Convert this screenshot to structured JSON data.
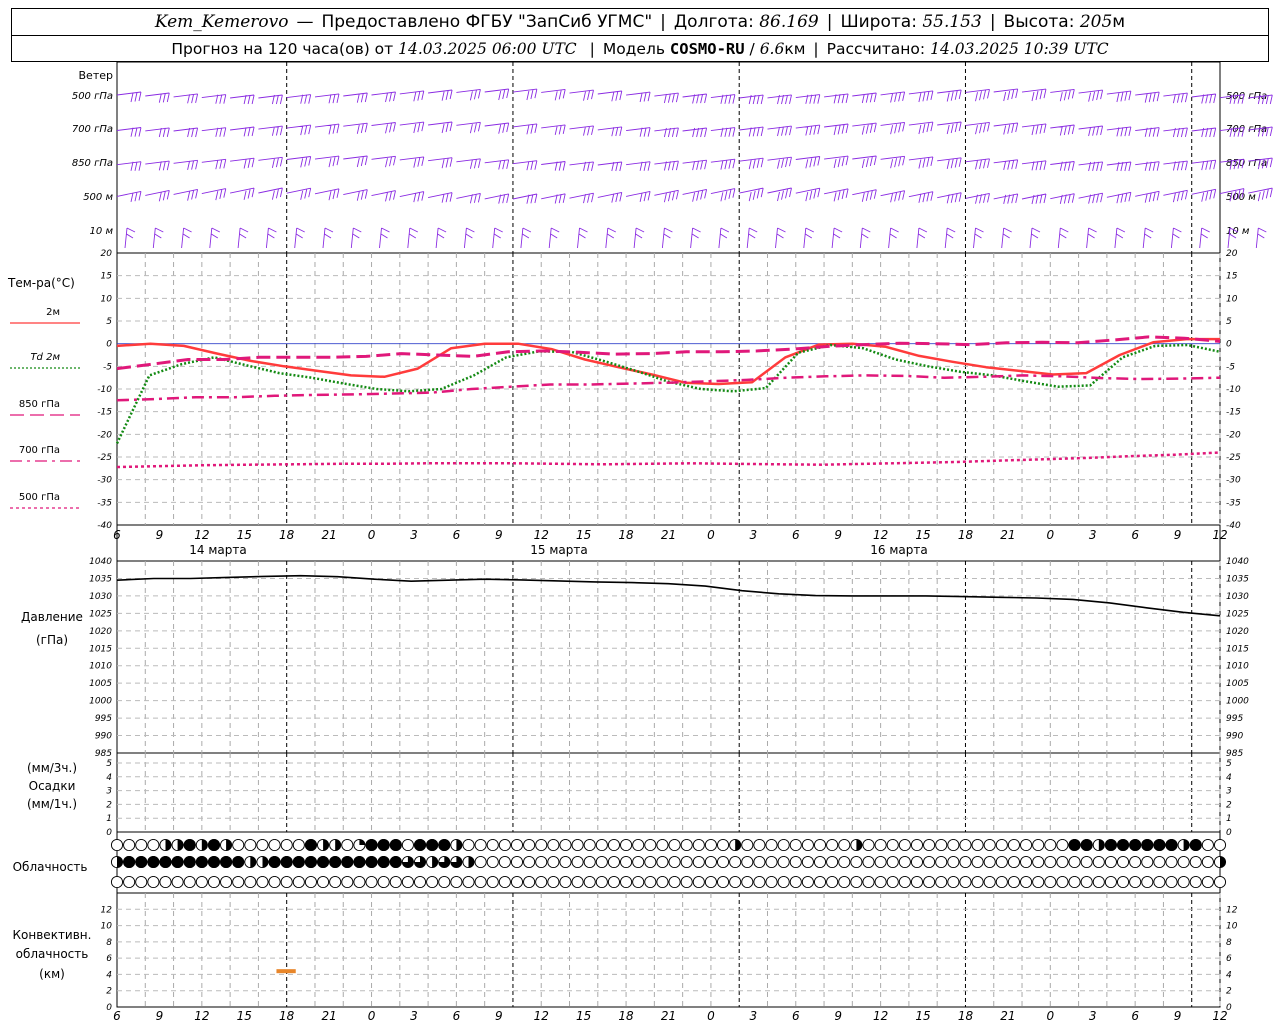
{
  "header": {
    "station": "Kem_Kemerovo",
    "dash": "—",
    "provided_by": "Предоставлено ФГБУ \"ЗапСиб УГМС\"",
    "lon_label": "Долгота:",
    "lon_value": "86.169",
    "lat_label": "Широта:",
    "lat_value": "55.153",
    "alt_label": "Высота:",
    "alt_value": "205",
    "alt_unit": "м",
    "forecast_label": "Прогноз на 120 часа(ов) от",
    "forecast_start": "14.03.2025 06:00 UTC",
    "model_label": "Модель",
    "model_name": "COSMO-RU",
    "model_sep": "/",
    "model_res": "6.6",
    "model_res_unit": "км",
    "calc_label": "Рассчитано:",
    "calc_time": "14.03.2025 10:39 UTC"
  },
  "chart_data": [
    {
      "type": "wind-barbs",
      "panel": "wind",
      "title": "Ветер",
      "levels": [
        "500 гПа",
        "700 гПа",
        "850 гПа",
        "500 м",
        "10  м"
      ],
      "hours_step": 3,
      "barb_color": "#8a2be2",
      "direction_note": "mostly westerly/south-westerly flow at all levels"
    },
    {
      "type": "line",
      "panel": "temperature",
      "ylabel": "Тем-ра(°C)",
      "ylim": [
        -40,
        20
      ],
      "yticks": [
        20,
        15,
        10,
        5,
        0,
        -5,
        -10,
        -15,
        -20,
        -25,
        -30,
        -35,
        -40
      ],
      "x_hours": [
        0,
        3,
        6,
        9,
        12,
        15,
        18,
        21,
        24,
        27,
        30,
        33,
        36,
        39,
        42,
        45,
        48,
        51,
        54,
        57,
        60,
        63,
        66,
        69,
        72,
        75,
        78,
        81,
        84,
        87,
        90,
        93,
        96,
        99,
        102,
        105,
        108,
        111,
        114,
        117,
        120
      ],
      "series": [
        {
          "name": "2м",
          "color": "#ff3b3b",
          "dash": "solid",
          "width": 2.5,
          "values": [
            -0.5,
            0,
            -0.5,
            -2.2,
            -3.8,
            -5,
            -6,
            -7,
            -7.3,
            -5.5,
            -1,
            0,
            0,
            -1.2,
            -3.5,
            -5.2,
            -6.8,
            -8.6,
            -8.9,
            -8.5,
            -3,
            -0.2,
            0,
            -0.7,
            -2.7,
            -4,
            -5.2,
            -6,
            -6.8,
            -6.5,
            -2.5,
            0.3,
            1,
            1
          ]
        },
        {
          "name": "Td  2м",
          "color": "#138a13",
          "dash": "2,2",
          "width": 2.5,
          "values": [
            -22,
            -7,
            -4.5,
            -3,
            -4.8,
            -6.5,
            -7.5,
            -8.8,
            -10,
            -10.5,
            -10,
            -7,
            -3,
            -1.7,
            -1.8,
            -3.8,
            -6,
            -8.4,
            -10,
            -10.5,
            -9.8,
            -2,
            -0.3,
            -1,
            -3.5,
            -5,
            -6.2,
            -7,
            -8.3,
            -9.5,
            -9.2,
            -3,
            -0.5,
            -0.3,
            -1.8
          ]
        },
        {
          "name": "850 гПа",
          "color": "#e0187a",
          "dash": "14,6",
          "width": 3,
          "values": [
            -5.5,
            -4.5,
            -3.5,
            -3.5,
            -3,
            -3,
            -3,
            -2.8,
            -2.2,
            -2.5,
            -2.8,
            -1.8,
            -1.6,
            -1.9,
            -2.3,
            -2.2,
            -1.8,
            -1.8,
            -1.6,
            -1.2,
            -0.6,
            -0.2,
            0.1,
            0,
            -0.2,
            0.2,
            0.3,
            0.2,
            0.8,
            1.5,
            1.2,
            0.5
          ]
        },
        {
          "name": "700 гПа",
          "color": "#e0187a",
          "dash": "12,5,3,5",
          "width": 2.5,
          "values": [
            -12.5,
            -12.2,
            -11.8,
            -11.8,
            -11.5,
            -11.3,
            -11.2,
            -11,
            -10.8,
            -10,
            -9.5,
            -9,
            -9,
            -8.8,
            -8.6,
            -8.3,
            -8,
            -7.5,
            -7.2,
            -7,
            -7.1,
            -7.5,
            -7.3,
            -7,
            -7.2,
            -7.6,
            -7.8,
            -7.7,
            -7.5
          ]
        },
        {
          "name": "500 гПа",
          "color": "#e0187a",
          "dash": "3,3",
          "width": 2.5,
          "values": [
            -27.2,
            -27,
            -26.8,
            -26.7,
            -26.6,
            -26.5,
            -26.5,
            -26.4,
            -26.4,
            -26.4,
            -26.5,
            -26.6,
            -26.5,
            -26.4,
            -26.5,
            -26.6,
            -26.7,
            -26.5,
            -26.3,
            -26.1,
            -25.8,
            -25.5,
            -25.2,
            -24.8,
            -24.5,
            -24
          ]
        }
      ]
    },
    {
      "type": "line",
      "panel": "pressure",
      "ylabel": "Давление",
      "ylabel_unit": "(гПа)",
      "ylim": [
        985,
        1040
      ],
      "yticks": [
        1040,
        1035,
        1030,
        1025,
        1020,
        1015,
        1010,
        1005,
        1000,
        995,
        990,
        985
      ],
      "series": [
        {
          "color": "#000000",
          "values": [
            1034.5,
            1035,
            1035,
            1035.3,
            1035.6,
            1035.8,
            1035.5,
            1034.8,
            1034.2,
            1034.5,
            1034.8,
            1034.6,
            1034.3,
            1034.0,
            1033.8,
            1033.5,
            1032.8,
            1031.5,
            1030.6,
            1030.1,
            1030.0,
            1030.0,
            1030.0,
            1029.8,
            1029.6,
            1029.4,
            1029.0,
            1028.0,
            1026.6,
            1025.3,
            1024.3
          ]
        }
      ]
    },
    {
      "type": "bar",
      "panel": "precipitation",
      "ylabel_top": "(мм/3ч.)",
      "ylabel_mid": "Осадки",
      "ylabel_bot": "(мм/1ч.)",
      "ylim": [
        0,
        5
      ],
      "yticks": [
        5,
        4,
        3,
        2,
        1,
        0
      ],
      "values": []
    },
    {
      "type": "symbols",
      "panel": "cloudiness",
      "ylabel": "Облачность",
      "rows": [
        "00004484840000008440388878884000000000000000000000040000000004000000000000000008848888884800",
        "48888888888448888888888866466400000000000000000000000000000000000000000000000000000000000004",
        "00000000000000000000000000000000000000000000000000000000000000000000000000000000000000000000"
      ]
    },
    {
      "type": "bar",
      "panel": "convective",
      "ylabel_1": "Конвективн.",
      "ylabel_2": "облачность",
      "ylabel_3": "(км)",
      "ylim": [
        0,
        14
      ],
      "yticks": [
        12,
        10,
        8,
        6,
        4,
        2,
        0
      ],
      "segments": [
        {
          "hour_from": 18,
          "hour_to": 21,
          "height_km": 4.4
        }
      ],
      "color": "#e8862a"
    }
  ],
  "axis": {
    "hour_labels": [
      "6",
      "9",
      "12",
      "15",
      "18",
      "21",
      "0",
      "3",
      "6",
      "9",
      "12",
      "15",
      "18",
      "21",
      "0",
      "3",
      "6",
      "9",
      "12",
      "15",
      "18",
      "21",
      "0",
      "3",
      "6",
      "9",
      "12"
    ],
    "day_labels": [
      "14 марта",
      "15 марта",
      "16 марта"
    ]
  }
}
